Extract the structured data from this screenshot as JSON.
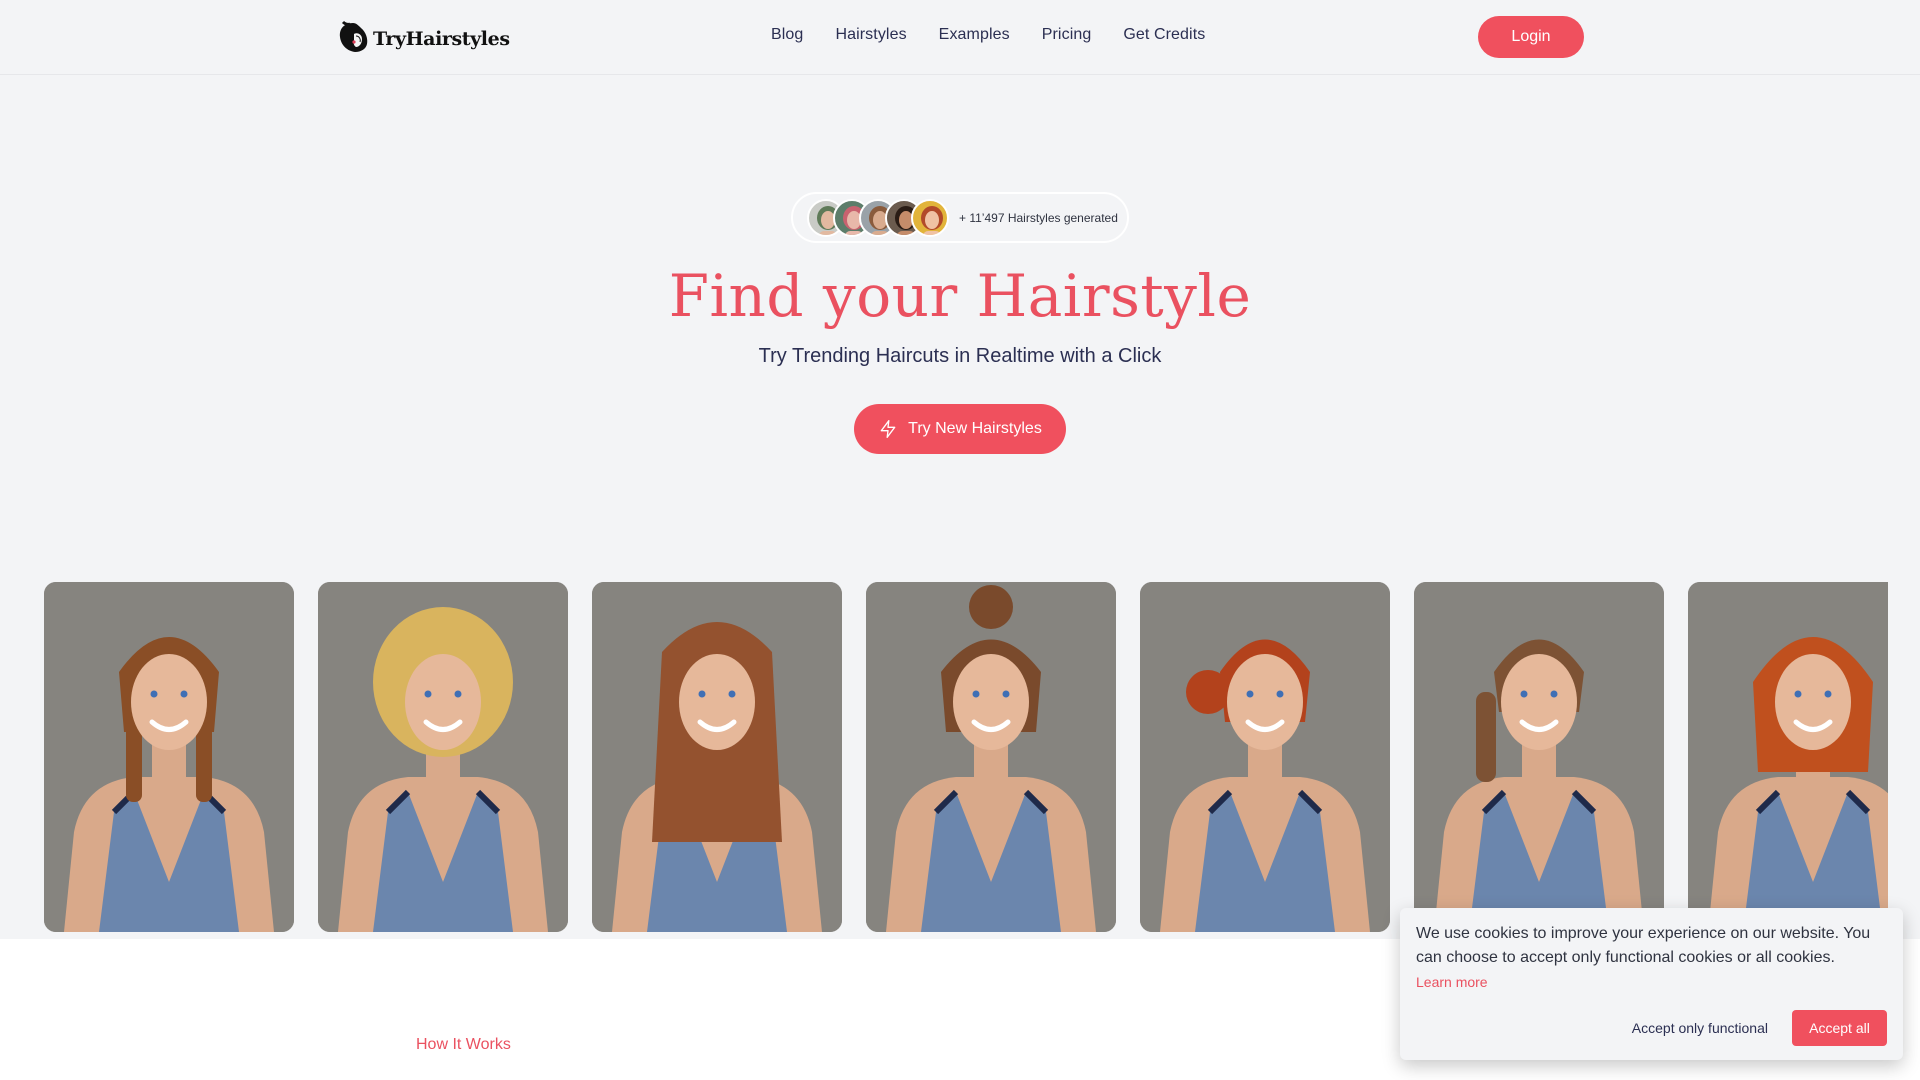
{
  "brand": {
    "name": "TryHairstyles",
    "accent_color": "#f0505e",
    "logo_icon": "woman-silhouette-icon"
  },
  "nav": {
    "items": [
      {
        "label": "Blog"
      },
      {
        "label": "Hairstyles"
      },
      {
        "label": "Examples"
      },
      {
        "label": "Pricing"
      },
      {
        "label": "Get Credits"
      }
    ],
    "login_label": "Login"
  },
  "hero": {
    "badge": {
      "text": "+ 11’497 Hairstyles generated",
      "avatars": [
        {
          "name": "man-green-cap",
          "bg": "#c9cbc6",
          "skin": "#e2b9a0",
          "hair": "#5f7a58"
        },
        {
          "name": "woman-pink-hair",
          "bg": "#5d7d6a",
          "skin": "#e8b8aa",
          "hair": "#c9626f"
        },
        {
          "name": "woman-short-brown",
          "bg": "#9aa2a8",
          "skin": "#d9ab8e",
          "hair": "#8a5b3c"
        },
        {
          "name": "woman-dark-curly",
          "bg": "#6b5b4e",
          "skin": "#c58c6a",
          "hair": "#2a1c15"
        },
        {
          "name": "woman-red-curly",
          "bg": "#e2b43a",
          "skin": "#f0c2a4",
          "hair": "#b24a2a"
        }
      ]
    },
    "title": "Find your Hairstyle",
    "subtitle": "Try Trending Haircuts in Realtime with a Click",
    "cta_label": "Try New Hairstyles",
    "cta_icon": "lightning-icon"
  },
  "gallery": {
    "items": [
      {
        "style": "braided-crown-auburn",
        "hair_color": "#8a4e26"
      },
      {
        "style": "blonde-curly-bob",
        "hair_color": "#d9b45e"
      },
      {
        "style": "long-straight-auburn",
        "hair_color": "#94522f"
      },
      {
        "style": "messy-top-bun",
        "hair_color": "#7a4a2c"
      },
      {
        "style": "red-side-bun",
        "hair_color": "#b3421c"
      },
      {
        "style": "side-braid-brown",
        "hair_color": "#7d5234"
      },
      {
        "style": "copper-bob",
        "hair_color": "#c0501e"
      }
    ]
  },
  "how_it_works": {
    "label": "How It Works"
  },
  "cookie_banner": {
    "text": "We use cookies to improve your experience on our website. You can choose to accept only functional cookies or all cookies.",
    "learn_more": "Learn more",
    "accept_functional": "Accept only functional",
    "accept_all": "Accept all"
  }
}
